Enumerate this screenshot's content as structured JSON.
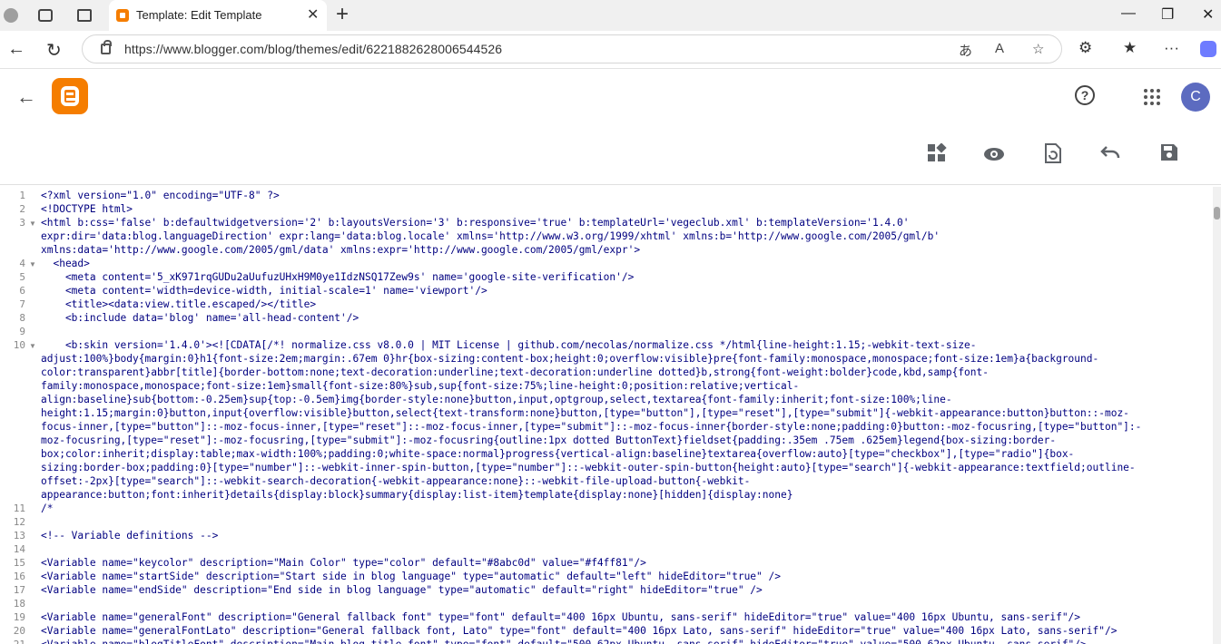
{
  "browser": {
    "tab_title": "Template: Edit Template",
    "url": "https://www.blogger.com/blog/themes/edit/6221882628006544526"
  },
  "header": {
    "avatar_letter": "C",
    "help_label": "?"
  },
  "editor": {
    "lines": [
      {
        "n": "1",
        "fold": false,
        "text": "<?xml version=\"1.0\" encoding=\"UTF-8\" ?>"
      },
      {
        "n": "2",
        "fold": false,
        "text": "<!DOCTYPE html>"
      },
      {
        "n": "3",
        "fold": true,
        "text": "<html b:css='false' b:defaultwidgetversion='2' b:layoutsVersion='3' b:responsive='true' b:templateUrl='vegeclub.xml' b:templateVersion='1.4.0'"
      },
      {
        "n": "",
        "fold": false,
        "text": "expr:dir='data:blog.languageDirection' expr:lang='data:blog.locale' xmlns='http://www.w3.org/1999/xhtml' xmlns:b='http://www.google.com/2005/gml/b'"
      },
      {
        "n": "",
        "fold": false,
        "text": "xmlns:data='http://www.google.com/2005/gml/data' xmlns:expr='http://www.google.com/2005/gml/expr'>"
      },
      {
        "n": "4",
        "fold": true,
        "text": "  <head>"
      },
      {
        "n": "5",
        "fold": false,
        "text": "    <meta content='5_xK971rqGUDu2aUufuzUHxH9M0ye1IdzNSQ17Zew9s' name='google-site-verification'/>"
      },
      {
        "n": "6",
        "fold": false,
        "text": "    <meta content='width=device-width, initial-scale=1' name='viewport'/>"
      },
      {
        "n": "7",
        "fold": false,
        "text": "    <title><data:view.title.escaped/></title>"
      },
      {
        "n": "8",
        "fold": false,
        "text": "    <b:include data='blog' name='all-head-content'/>"
      },
      {
        "n": "9",
        "fold": false,
        "text": ""
      },
      {
        "n": "10",
        "fold": true,
        "text": "    <b:skin version='1.4.0'><![CDATA[/*! normalize.css v8.0.0 | MIT License | github.com/necolas/normalize.css */html{line-height:1.15;-webkit-text-size-"
      },
      {
        "n": "",
        "fold": false,
        "text": "adjust:100%}body{margin:0}h1{font-size:2em;margin:.67em 0}hr{box-sizing:content-box;height:0;overflow:visible}pre{font-family:monospace,monospace;font-size:1em}a{background-"
      },
      {
        "n": "",
        "fold": false,
        "text": "color:transparent}abbr[title]{border-bottom:none;text-decoration:underline;text-decoration:underline dotted}b,strong{font-weight:bolder}code,kbd,samp{font-"
      },
      {
        "n": "",
        "fold": false,
        "text": "family:monospace,monospace;font-size:1em}small{font-size:80%}sub,sup{font-size:75%;line-height:0;position:relative;vertical-"
      },
      {
        "n": "",
        "fold": false,
        "text": "align:baseline}sub{bottom:-0.25em}sup{top:-0.5em}img{border-style:none}button,input,optgroup,select,textarea{font-family:inherit;font-size:100%;line-"
      },
      {
        "n": "",
        "fold": false,
        "text": "height:1.15;margin:0}button,input{overflow:visible}button,select{text-transform:none}button,[type=\"button\"],[type=\"reset\"],[type=\"submit\"]{-webkit-appearance:button}button::-moz-"
      },
      {
        "n": "",
        "fold": false,
        "text": "focus-inner,[type=\"button\"]::-moz-focus-inner,[type=\"reset\"]::-moz-focus-inner,[type=\"submit\"]::-moz-focus-inner{border-style:none;padding:0}button:-moz-focusring,[type=\"button\"]:-"
      },
      {
        "n": "",
        "fold": false,
        "text": "moz-focusring,[type=\"reset\"]:-moz-focusring,[type=\"submit\"]:-moz-focusring{outline:1px dotted ButtonText}fieldset{padding:.35em .75em .625em}legend{box-sizing:border-"
      },
      {
        "n": "",
        "fold": false,
        "text": "box;color:inherit;display:table;max-width:100%;padding:0;white-space:normal}progress{vertical-align:baseline}textarea{overflow:auto}[type=\"checkbox\"],[type=\"radio\"]{box-"
      },
      {
        "n": "",
        "fold": false,
        "text": "sizing:border-box;padding:0}[type=\"number\"]::-webkit-inner-spin-button,[type=\"number\"]::-webkit-outer-spin-button{height:auto}[type=\"search\"]{-webkit-appearance:textfield;outline-"
      },
      {
        "n": "",
        "fold": false,
        "text": "offset:-2px}[type=\"search\"]::-webkit-search-decoration{-webkit-appearance:none}::-webkit-file-upload-button{-webkit-"
      },
      {
        "n": "",
        "fold": false,
        "text": "appearance:button;font:inherit}details{display:block}summary{display:list-item}template{display:none}[hidden]{display:none}"
      },
      {
        "n": "11",
        "fold": false,
        "text": "/*"
      },
      {
        "n": "12",
        "fold": false,
        "text": ""
      },
      {
        "n": "13",
        "fold": false,
        "text": "<!-- Variable definitions -->"
      },
      {
        "n": "14",
        "fold": false,
        "text": ""
      },
      {
        "n": "15",
        "fold": false,
        "text": "<Variable name=\"keycolor\" description=\"Main Color\" type=\"color\" default=\"#8abc0d\" value=\"#f4ff81\"/>"
      },
      {
        "n": "16",
        "fold": false,
        "text": "<Variable name=\"startSide\" description=\"Start side in blog language\" type=\"automatic\" default=\"left\" hideEditor=\"true\" />"
      },
      {
        "n": "17",
        "fold": false,
        "text": "<Variable name=\"endSide\" description=\"End side in blog language\" type=\"automatic\" default=\"right\" hideEditor=\"true\" />"
      },
      {
        "n": "18",
        "fold": false,
        "text": ""
      },
      {
        "n": "19",
        "fold": false,
        "text": "<Variable name=\"generalFont\" description=\"General fallback font\" type=\"font\" default=\"400 16px Ubuntu, sans-serif\" hideEditor=\"true\" value=\"400 16px Ubuntu, sans-serif\"/>"
      },
      {
        "n": "20",
        "fold": false,
        "text": "<Variable name=\"generalFontLato\" description=\"General fallback font, Lato\" type=\"font\" default=\"400 16px Lato, sans-serif\" hideEditor=\"true\" value=\"400 16px Lato, sans-serif\"/>"
      },
      {
        "n": "21",
        "fold": false,
        "text": "<Variable name=\"blogTitleFont\" description=\"Main blog title font\" type=\"font\" default=\"500 62px Ubuntu, sans-serif\" hideEditor=\"true\" value=\"500 62px Ubuntu, sans-serif\"/>"
      }
    ]
  }
}
